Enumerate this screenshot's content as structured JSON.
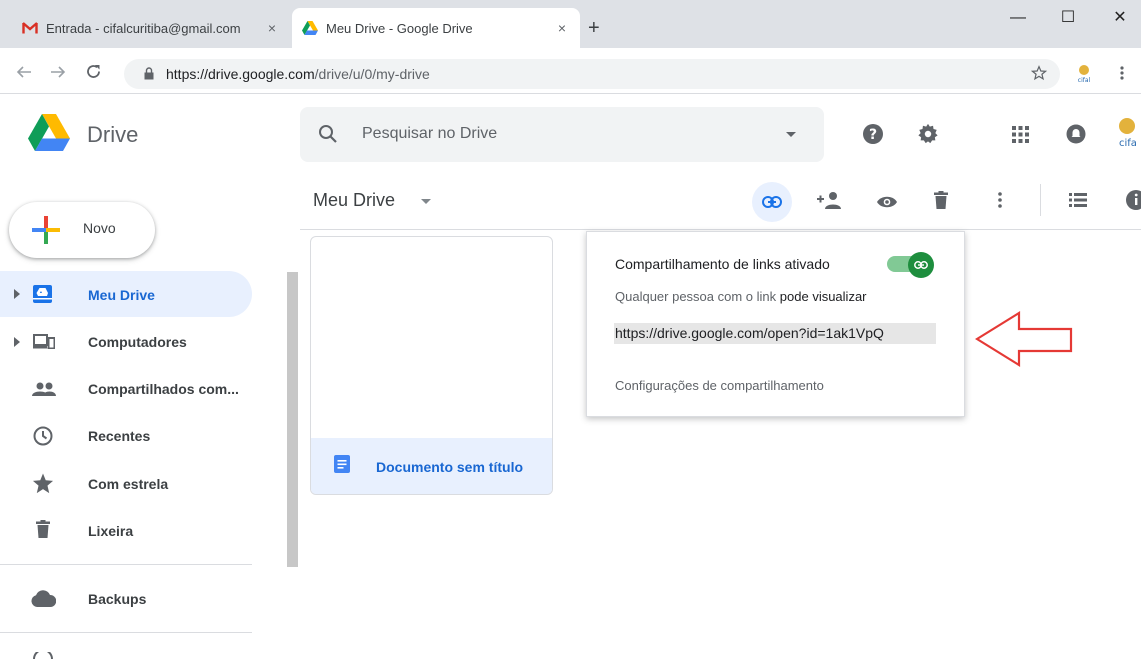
{
  "browser": {
    "tabs": [
      {
        "title": "Entrada - cifalcuritiba@gmail.com",
        "close": "×"
      },
      {
        "title": "Meu Drive - Google Drive",
        "close": "×"
      }
    ],
    "new_tab": "+",
    "window_controls": {
      "minimize": "—",
      "maximize": "☐",
      "close": "✕"
    },
    "url_host": "https://drive.google.com",
    "url_path": "/drive/u/0/my-drive",
    "icons": [
      "back-icon",
      "forward-icon",
      "reload-icon",
      "lock-icon",
      "star-icon",
      "profile-icon",
      "menu-icon"
    ]
  },
  "drive": {
    "app_name": "Drive",
    "search_placeholder": "Pesquisar no Drive",
    "breadcrumb": "Meu Drive",
    "new_button": "Novo",
    "nav": [
      {
        "label": "Meu Drive",
        "icon": "my-drive-icon",
        "expandable": true,
        "active": true
      },
      {
        "label": "Computadores",
        "icon": "computers-icon",
        "expandable": true
      },
      {
        "label": "Compartilhados com...",
        "icon": "shared-icon"
      },
      {
        "label": "Recentes",
        "icon": "clock-icon"
      },
      {
        "label": "Com estrela",
        "icon": "star-icon"
      },
      {
        "label": "Lixeira",
        "icon": "trash-icon"
      },
      {
        "label": "Backups",
        "icon": "cloud-icon"
      }
    ],
    "file": {
      "name": "Documento sem título",
      "icon": "docs-icon"
    },
    "share_popup": {
      "title": "Compartilhamento de links ativado",
      "subtitle_prefix": "Qualquer pessoa com o link",
      "subtitle_strong": "pode visualizar",
      "link": "https://drive.google.com/open?id=1ak1VpQ",
      "settings": "Configurações de compartilhamento",
      "toggle_on": true
    },
    "colors": {
      "accent": "#1a73e8",
      "toggle": "#1e8e3e",
      "arrow": "#e53935"
    }
  }
}
